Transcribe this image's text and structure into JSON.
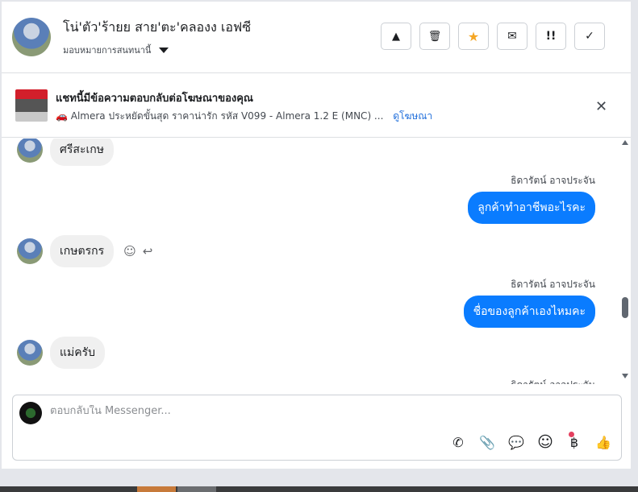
{
  "header": {
    "contact_name": "โน่'ตัว'ร้ายย สาย'ตะ'คลองง เอฟซี",
    "assign_label": "มอบหมายการสนทนานี้",
    "buttons": [
      {
        "name": "report",
        "icon": "warning-icon",
        "glyph": "▲"
      },
      {
        "name": "delete",
        "icon": "trash-icon",
        "glyph": "🗑"
      },
      {
        "name": "star",
        "icon": "star-icon",
        "glyph": "★"
      },
      {
        "name": "unread",
        "icon": "envelope-icon",
        "glyph": "✉"
      },
      {
        "name": "follow-up",
        "icon": "follow-up-icon",
        "glyph": "!!"
      },
      {
        "name": "done",
        "icon": "checkmark-icon",
        "glyph": "✓"
      }
    ]
  },
  "ad": {
    "title": "แชทนี้มีข้อความตอบกลับต่อโฆษณาของคุณ",
    "description": "🚗 Almera ประหยัดขั้นสุด ราคาน่ารัก รหัส V099 - Almera 1.2 E (MNC) ...",
    "link": "ดูโฆษณา",
    "close_glyph": "✕"
  },
  "messages": [
    {
      "direction": "in",
      "text": "ศรีสะเกษ"
    },
    {
      "direction": "out",
      "sender": "ธิดารัตน์ อาจประจัน",
      "text": "ลูกค้าทำอาชีพอะไรคะ"
    },
    {
      "direction": "in",
      "text": "เกษตรกร"
    },
    {
      "direction": "out",
      "sender": "ธิดารัตน์ อาจประจัน",
      "text": "ชื่อของลูกค้าเองไหมคะ"
    },
    {
      "direction": "in",
      "text": "แม่ครับ"
    },
    {
      "direction": "out",
      "sender": "ธิดารัตน์ อาจประจัน",
      "text": ""
    }
  ],
  "reactions": {
    "emoji_glyph": "☺",
    "reply_glyph": "↩"
  },
  "composer": {
    "placeholder": "ตอบกลับใน Messenger...",
    "tools": [
      {
        "icon": "phone-add-icon",
        "glyph": "✆"
      },
      {
        "icon": "paperclip-icon",
        "glyph": "📎"
      },
      {
        "icon": "chat-bubble-icon",
        "glyph": "💬"
      },
      {
        "icon": "emoji-icon",
        "glyph": "☺"
      },
      {
        "icon": "baht-icon",
        "glyph": "฿"
      },
      {
        "icon": "thumbs-up-icon",
        "glyph": "👍"
      }
    ]
  },
  "colors": {
    "accent": "#0a7cff",
    "link": "#216fdb",
    "notice_dot": "#e4405f",
    "star": "#f5a623"
  }
}
